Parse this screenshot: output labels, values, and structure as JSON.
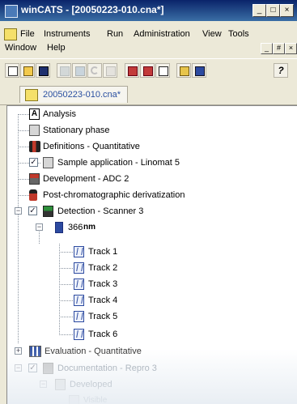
{
  "window": {
    "title": "winCATS - [20050223-010.cna*]",
    "caption_buttons": [
      "_",
      "□",
      "×"
    ]
  },
  "menu": {
    "row1": [
      "File",
      "Instruments",
      "Run",
      "Administration",
      "View",
      "Tools"
    ],
    "row2": [
      "Window",
      "Help"
    ],
    "mdi_buttons": [
      "_",
      "#",
      "×"
    ]
  },
  "tab": {
    "label": "20050223-010.cna*"
  },
  "tree": {
    "nodes": [
      {
        "label": "Analysis"
      },
      {
        "label": "Stationary phase"
      },
      {
        "label": "Definitions - Quantitative"
      },
      {
        "label": "Sample application - Linomat 5"
      },
      {
        "label": "Development - ADC 2"
      },
      {
        "label": "Post-chromatographic derivatization"
      },
      {
        "label": "Detection - Scanner 3"
      },
      {
        "label": "366",
        "unit": "nm"
      },
      {
        "label": "Track 1"
      },
      {
        "label": "Track 2"
      },
      {
        "label": "Track 3"
      },
      {
        "label": "Track 4"
      },
      {
        "label": "Track 5"
      },
      {
        "label": "Track 6"
      },
      {
        "label": "Evaluation - Quantitative"
      },
      {
        "label": "Documentation - Repro 3"
      },
      {
        "label": "Developed"
      },
      {
        "label": "Visible"
      }
    ]
  },
  "colors": {
    "titlebar": "#0a246a",
    "link_blue": "#2a4fa0",
    "track_icon": "#2c4aa0"
  }
}
